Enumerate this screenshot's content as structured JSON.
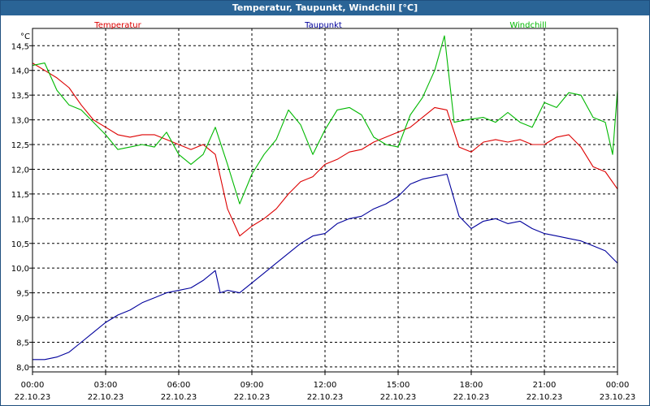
{
  "window": {
    "title": "Temperatur, Taupunkt, Windchill [°C]"
  },
  "chart_data": {
    "type": "line",
    "title": "Temperatur, Taupunkt, Windchill [°C]",
    "ylabel": "°C",
    "ylim": [
      7.9,
      14.85
    ],
    "yticks": [
      "8,0",
      "8,5",
      "9,0",
      "9,5",
      "10,0",
      "10,5",
      "11,0",
      "11,5",
      "12,0",
      "12,5",
      "13,0",
      "13,5",
      "14,0",
      "14,5"
    ],
    "xticks": [
      {
        "time": "00:00",
        "date": "22.10.23"
      },
      {
        "time": "03:00",
        "date": "22.10.23"
      },
      {
        "time": "06:00",
        "date": "22.10.23"
      },
      {
        "time": "09:00",
        "date": "22.10.23"
      },
      {
        "time": "12:00",
        "date": "22.10.23"
      },
      {
        "time": "15:00",
        "date": "22.10.23"
      },
      {
        "time": "18:00",
        "date": "22.10.23"
      },
      {
        "time": "21:00",
        "date": "22.10.23"
      },
      {
        "time": "00:00",
        "date": "23.10.23"
      }
    ],
    "x_unit": "hours",
    "grid": true,
    "legend_position": "top",
    "series": [
      {
        "name": "Temperatur",
        "color": "#dd0000",
        "points": [
          [
            0,
            14.15
          ],
          [
            0.5,
            14.0
          ],
          [
            1.0,
            13.85
          ],
          [
            1.5,
            13.65
          ],
          [
            2.0,
            13.3
          ],
          [
            2.5,
            13.0
          ],
          [
            3.0,
            12.85
          ],
          [
            3.5,
            12.7
          ],
          [
            4.0,
            12.65
          ],
          [
            4.5,
            12.7
          ],
          [
            5.0,
            12.7
          ],
          [
            5.5,
            12.6
          ],
          [
            6.0,
            12.5
          ],
          [
            6.5,
            12.4
          ],
          [
            7.0,
            12.5
          ],
          [
            7.5,
            12.3
          ],
          [
            8.0,
            11.2
          ],
          [
            8.5,
            10.65
          ],
          [
            9.0,
            10.85
          ],
          [
            9.5,
            11.0
          ],
          [
            10.0,
            11.2
          ],
          [
            10.5,
            11.5
          ],
          [
            11.0,
            11.75
          ],
          [
            11.5,
            11.85
          ],
          [
            12.0,
            12.1
          ],
          [
            12.5,
            12.2
          ],
          [
            13.0,
            12.35
          ],
          [
            13.5,
            12.4
          ],
          [
            14.0,
            12.55
          ],
          [
            14.5,
            12.65
          ],
          [
            15.0,
            12.75
          ],
          [
            15.5,
            12.85
          ],
          [
            16.0,
            13.05
          ],
          [
            16.5,
            13.25
          ],
          [
            17.0,
            13.2
          ],
          [
            17.5,
            12.45
          ],
          [
            18.0,
            12.35
          ],
          [
            18.5,
            12.55
          ],
          [
            19.0,
            12.6
          ],
          [
            19.5,
            12.55
          ],
          [
            20.0,
            12.6
          ],
          [
            20.5,
            12.5
          ],
          [
            21.0,
            12.5
          ],
          [
            21.5,
            12.65
          ],
          [
            22.0,
            12.7
          ],
          [
            22.5,
            12.45
          ],
          [
            23.0,
            12.05
          ],
          [
            23.5,
            11.95
          ],
          [
            24.0,
            11.6
          ]
        ]
      },
      {
        "name": "Taupunkt",
        "color": "#00009c",
        "points": [
          [
            0,
            8.15
          ],
          [
            0.5,
            8.15
          ],
          [
            1.0,
            8.2
          ],
          [
            1.5,
            8.3
          ],
          [
            2.0,
            8.5
          ],
          [
            2.5,
            8.7
          ],
          [
            3.0,
            8.9
          ],
          [
            3.5,
            9.05
          ],
          [
            4.0,
            9.15
          ],
          [
            4.5,
            9.3
          ],
          [
            5.0,
            9.4
          ],
          [
            5.5,
            9.5
          ],
          [
            6.0,
            9.55
          ],
          [
            6.5,
            9.6
          ],
          [
            7.0,
            9.75
          ],
          [
            7.5,
            9.95
          ],
          [
            7.7,
            9.5
          ],
          [
            8.0,
            9.55
          ],
          [
            8.5,
            9.5
          ],
          [
            9.0,
            9.7
          ],
          [
            9.5,
            9.9
          ],
          [
            10.0,
            10.1
          ],
          [
            10.5,
            10.3
          ],
          [
            11.0,
            10.5
          ],
          [
            11.5,
            10.65
          ],
          [
            12.0,
            10.7
          ],
          [
            12.5,
            10.9
          ],
          [
            13.0,
            11.0
          ],
          [
            13.5,
            11.05
          ],
          [
            14.0,
            11.2
          ],
          [
            14.5,
            11.3
          ],
          [
            15.0,
            11.45
          ],
          [
            15.5,
            11.7
          ],
          [
            16.0,
            11.8
          ],
          [
            16.5,
            11.85
          ],
          [
            17.0,
            11.9
          ],
          [
            17.5,
            11.05
          ],
          [
            18.0,
            10.8
          ],
          [
            18.5,
            10.95
          ],
          [
            19.0,
            11.0
          ],
          [
            19.5,
            10.9
          ],
          [
            20.0,
            10.95
          ],
          [
            20.5,
            10.8
          ],
          [
            21.0,
            10.7
          ],
          [
            21.5,
            10.65
          ],
          [
            22.0,
            10.6
          ],
          [
            22.5,
            10.55
          ],
          [
            23.0,
            10.45
          ],
          [
            23.5,
            10.35
          ],
          [
            24.0,
            10.1
          ]
        ]
      },
      {
        "name": "Windchill",
        "color": "#00b800",
        "points": [
          [
            0,
            14.1
          ],
          [
            0.5,
            14.15
          ],
          [
            1.0,
            13.6
          ],
          [
            1.5,
            13.3
          ],
          [
            2.0,
            13.2
          ],
          [
            2.5,
            12.95
          ],
          [
            3.0,
            12.7
          ],
          [
            3.5,
            12.4
          ],
          [
            4.0,
            12.45
          ],
          [
            4.5,
            12.5
          ],
          [
            5.0,
            12.45
          ],
          [
            5.5,
            12.75
          ],
          [
            6.0,
            12.3
          ],
          [
            6.5,
            12.1
          ],
          [
            7.0,
            12.3
          ],
          [
            7.5,
            12.85
          ],
          [
            8.0,
            12.1
          ],
          [
            8.5,
            11.3
          ],
          [
            9.0,
            11.9
          ],
          [
            9.5,
            12.3
          ],
          [
            10.0,
            12.6
          ],
          [
            10.5,
            13.2
          ],
          [
            11.0,
            12.9
          ],
          [
            11.5,
            12.3
          ],
          [
            12.0,
            12.8
          ],
          [
            12.5,
            13.2
          ],
          [
            13.0,
            13.25
          ],
          [
            13.5,
            13.1
          ],
          [
            14.0,
            12.65
          ],
          [
            14.5,
            12.5
          ],
          [
            15.0,
            12.45
          ],
          [
            15.5,
            13.1
          ],
          [
            16.0,
            13.45
          ],
          [
            16.5,
            14.0
          ],
          [
            16.9,
            14.7
          ],
          [
            17.3,
            12.95
          ],
          [
            17.8,
            13.0
          ],
          [
            18.5,
            13.05
          ],
          [
            19.0,
            12.95
          ],
          [
            19.5,
            13.15
          ],
          [
            20.0,
            12.95
          ],
          [
            20.5,
            12.85
          ],
          [
            21.0,
            13.35
          ],
          [
            21.5,
            13.25
          ],
          [
            22.0,
            13.55
          ],
          [
            22.5,
            13.5
          ],
          [
            23.0,
            13.05
          ],
          [
            23.5,
            12.95
          ],
          [
            23.8,
            12.3
          ],
          [
            24.0,
            13.6
          ]
        ]
      }
    ]
  }
}
